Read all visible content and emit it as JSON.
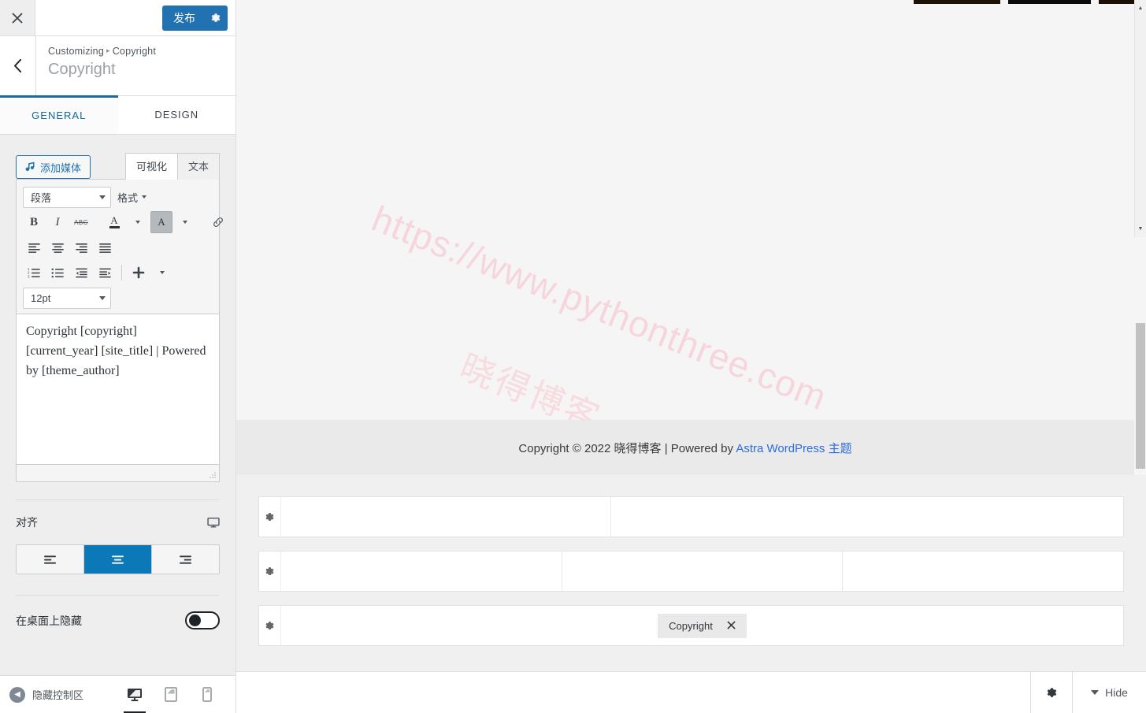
{
  "customizer": {
    "close_icon": "close-x-icon",
    "publish_label": "发布",
    "publish_gear_icon": "gear-icon",
    "back_icon": "chevron-left-icon",
    "breadcrumb_root": "Customizing",
    "breadcrumb_sep": "▸",
    "breadcrumb_current": "Copyright",
    "panel_title": "Copyright",
    "tabs": [
      {
        "label": "GENERAL",
        "active": true
      },
      {
        "label": "DESIGN",
        "active": false
      }
    ],
    "accent_color": "#2271b1",
    "active_tab_color": "#0b6a9e"
  },
  "editor": {
    "add_media_label": "添加媒体",
    "mode_tabs": [
      {
        "label": "可视化",
        "active": true
      },
      {
        "label": "文本",
        "active": false
      }
    ],
    "paragraph_select": "段落",
    "format_button": "格式",
    "font_size_select": "12pt",
    "toolbar_buttons": [
      {
        "name": "bold",
        "glyph": "B"
      },
      {
        "name": "italic",
        "glyph": "I"
      },
      {
        "name": "strikethrough",
        "glyph": "ABC"
      },
      {
        "name": "text-color",
        "glyph": "A"
      },
      {
        "name": "background-color",
        "glyph": "A"
      },
      {
        "name": "insert-link",
        "glyph": "link"
      },
      {
        "name": "align-left",
        "glyph": "align-left"
      },
      {
        "name": "align-center",
        "glyph": "align-center"
      },
      {
        "name": "align-right",
        "glyph": "align-right"
      },
      {
        "name": "align-justify",
        "glyph": "align-justify"
      },
      {
        "name": "numbered-list",
        "glyph": "ol"
      },
      {
        "name": "bulleted-list",
        "glyph": "ul"
      },
      {
        "name": "outdent",
        "glyph": "outdent"
      },
      {
        "name": "indent",
        "glyph": "indent"
      },
      {
        "name": "insert-more",
        "glyph": "+"
      }
    ],
    "content": "Copyright [copyright] [current_year] [site_title] | Powered by [theme_author]"
  },
  "align_control": {
    "label": "对齐",
    "responsive_icon": "desktop-icon",
    "options": [
      {
        "name": "align-left",
        "active": false
      },
      {
        "name": "align-center",
        "active": true
      },
      {
        "name": "align-right",
        "active": false
      }
    ]
  },
  "hide_control": {
    "label": "在桌面上隐藏",
    "state": "off"
  },
  "customizer_footer": {
    "collapse_label": "隐藏控制区",
    "devices": [
      {
        "name": "desktop",
        "active": true
      },
      {
        "name": "tablet",
        "active": false
      },
      {
        "name": "mobile",
        "active": false
      }
    ]
  },
  "preview": {
    "watermark_line1": "https://www.pythonthree.com",
    "watermark_line2": "晓得博客",
    "footer_text_before": "Copyright © 2022 晓得博客 | Powered by ",
    "footer_link": "Astra WordPress 主题",
    "footer_link_color": "#2d6cdf"
  },
  "footer_builder": {
    "rows": [
      {
        "name": "above-footer-row",
        "columns": 2,
        "gear_icon": "gear-icon",
        "items": []
      },
      {
        "name": "primary-footer-row",
        "columns": 3,
        "gear_icon": "gear-icon",
        "items": []
      },
      {
        "name": "below-footer-row",
        "columns": 1,
        "gear_icon": "gear-icon",
        "items": [
          {
            "label": "Copyright",
            "remove_icon": "close-x-icon"
          }
        ]
      }
    ]
  },
  "preview_bottom_bar": {
    "gear_icon": "gear-icon",
    "hide_label": "Hide",
    "chevron_icon": "chevron-down-icon"
  }
}
